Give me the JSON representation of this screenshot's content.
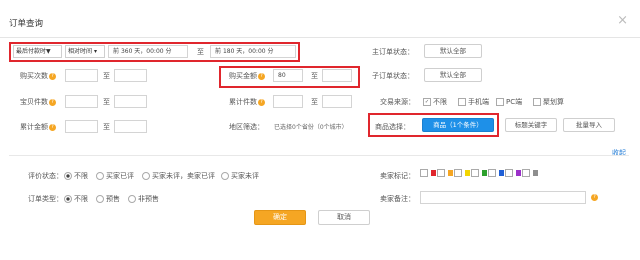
{
  "dialog": {
    "title": "订单查询",
    "close_glyph": "×"
  },
  "row1": {
    "time_type": "最后付款时▼",
    "time_range_type": "相对时间",
    "start_prefix": "前",
    "start_value": "360 天，00:00 分",
    "to": "至",
    "end_prefix": "前",
    "end_value": "180 天，00:00 分",
    "main_order_status_label": "主订单状态：",
    "main_order_status_value": "默认全部"
  },
  "row2": {
    "buy_count_label": "购买次数",
    "to1": "至",
    "buy_amount_label": "购买金额",
    "buy_amount_min": "80",
    "to2": "至",
    "sub_order_status_label": "子订单状态：",
    "sub_order_status_value": "默认全部"
  },
  "row3": {
    "baby_count_label": "宝贝件数",
    "to1": "至",
    "total_count_label": "累计件数",
    "to2": "至",
    "trade_source_label": "交易来源：",
    "sources": [
      "不限",
      "手机端",
      "PC端",
      "聚划算"
    ]
  },
  "row4": {
    "total_amount_label": "累计金额",
    "to": "至",
    "region_label": "地区筛选：",
    "region_value": "已选择0个省份（0个城市）",
    "product_select_label": "商品选择：",
    "product_button": "商品（1个条件）",
    "title_keyword_button": "标题关键字",
    "batch_import_button": "批量导入"
  },
  "collapse_link": "收起",
  "eval": {
    "label": "评价状态：",
    "options": [
      "不限",
      "买家已评",
      "买家未评，卖家已评",
      "买家未评"
    ]
  },
  "seller_flag_label": "卖家标记：",
  "flag_colors": [
    "#e0262d",
    "#f5a623",
    "#f2d500",
    "#2ca02c",
    "#1f5fd6",
    "#9b30c9",
    "#8e8e8e"
  ],
  "order_type": {
    "label": "订单类型：",
    "options": [
      "不限",
      "预售",
      "非预售"
    ]
  },
  "seller_note_label": "卖家备注：",
  "buttons": {
    "confirm": "确定",
    "cancel": "取消"
  }
}
